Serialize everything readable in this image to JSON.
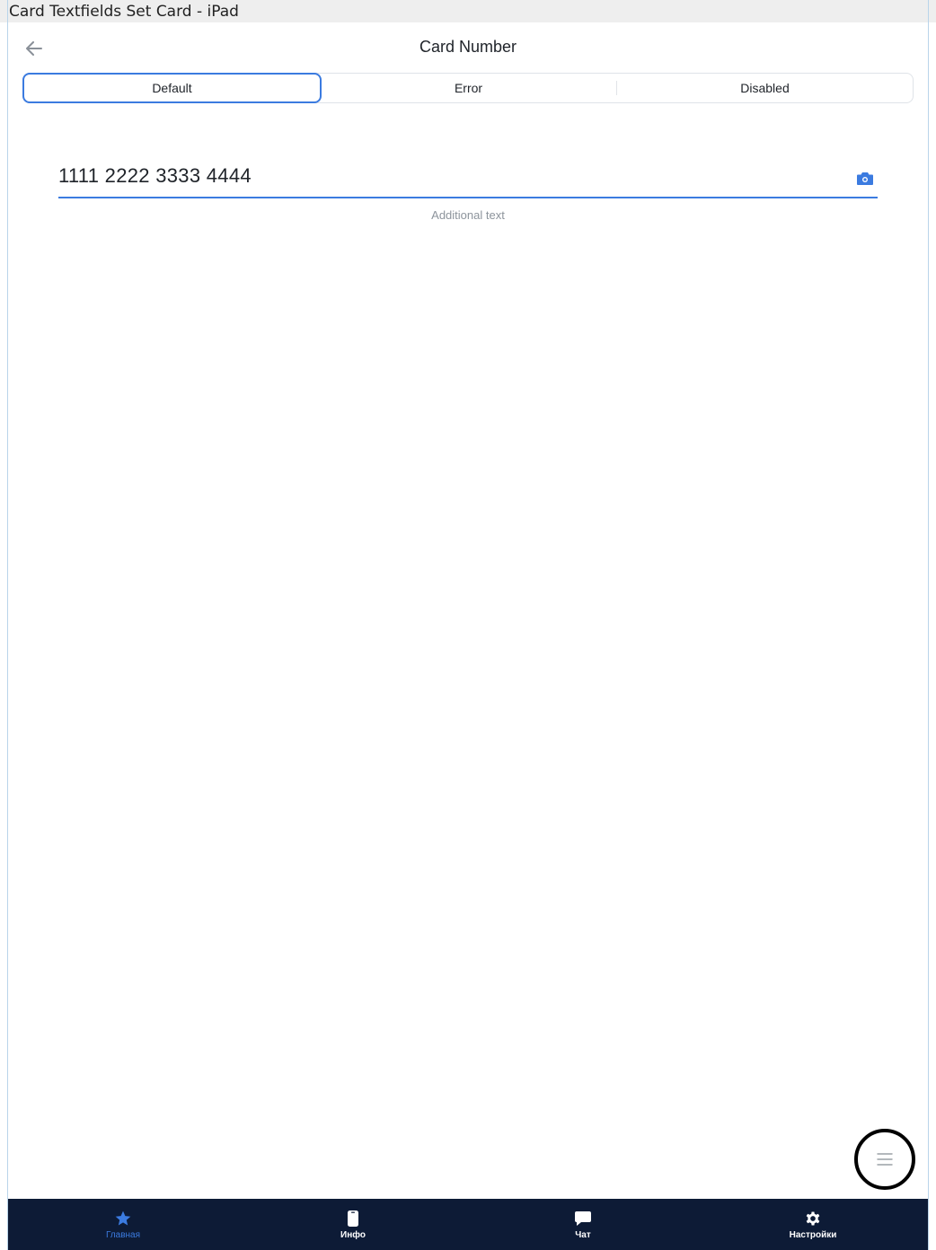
{
  "window": {
    "title": "Card Textfields Set Card - iPad"
  },
  "header": {
    "title": "Card Number",
    "back_icon": "arrow-left-icon"
  },
  "segments": [
    {
      "label": "Default",
      "selected": true
    },
    {
      "label": "Error",
      "selected": false
    },
    {
      "label": "Disabled",
      "selected": false
    }
  ],
  "field": {
    "value": "1111 2222 3333 4444",
    "helper": "Additional text",
    "trailing_icon": "camera-icon"
  },
  "fab": {
    "icon": "menu-icon"
  },
  "tabbar": {
    "items": [
      {
        "label": "Главная",
        "icon": "star-icon",
        "active": true
      },
      {
        "label": "Инфо",
        "icon": "phone-icon",
        "active": false
      },
      {
        "label": "Чат",
        "icon": "chat-bubble-icon",
        "active": false
      },
      {
        "label": "Настройки",
        "icon": "gear-icon",
        "active": false
      }
    ]
  },
  "colors": {
    "accent": "#3b7be0",
    "tabbar_bg": "#0d1b36",
    "helper": "#8d949c"
  }
}
